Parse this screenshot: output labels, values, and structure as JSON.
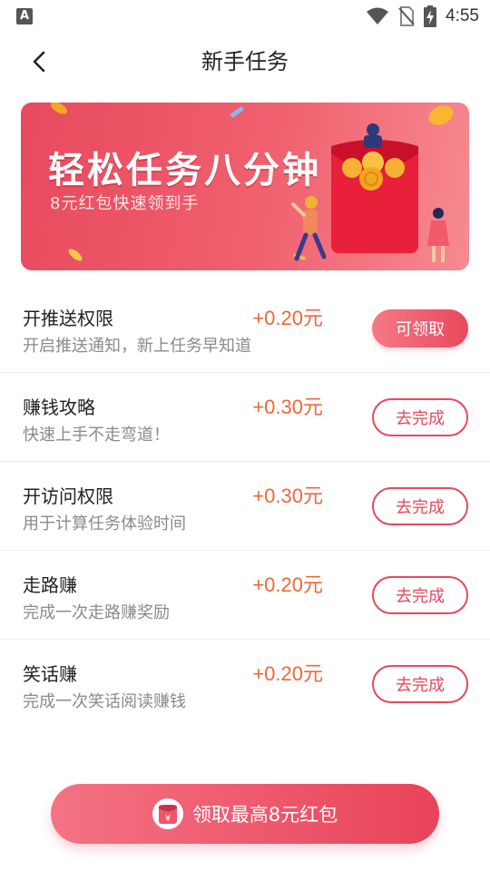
{
  "status_bar": {
    "notification_glyph": "A",
    "time": "4:55",
    "icons": [
      "wifi-icon",
      "no-sim-icon",
      "battery-charging-icon"
    ]
  },
  "header": {
    "title": "新手任务",
    "back_icon": "back-arrow-icon"
  },
  "banner": {
    "title": "轻松任务八分钟",
    "subtitle": "8元红包快速领到手"
  },
  "tasks": [
    {
      "title": "开推送权限",
      "desc": "开启推送通知，新上任务早知道",
      "reward": "+0.20元",
      "action": "可领取",
      "state": "claim"
    },
    {
      "title": "赚钱攻略",
      "desc": "快速上手不走弯道！",
      "reward": "+0.30元",
      "action": "去完成",
      "state": "todo"
    },
    {
      "title": "开访问权限",
      "desc": "用于计算任务体验时间",
      "reward": "+0.30元",
      "action": "去完成",
      "state": "todo"
    },
    {
      "title": "走路赚",
      "desc": "完成一次走路赚奖励",
      "reward": "+0.20元",
      "action": "去完成",
      "state": "todo"
    },
    {
      "title": "笑话赚",
      "desc": "完成一次笑话阅读赚钱",
      "reward": "+0.20元",
      "action": "去完成",
      "state": "todo"
    }
  ],
  "cta": {
    "label": "领取最高8元红包",
    "icon_glyph": "¥",
    "icon": "red-packet-icon"
  },
  "colors": {
    "accent": "#e8485c",
    "reward": "#f0663a",
    "subtext": "#8a8a8a"
  }
}
